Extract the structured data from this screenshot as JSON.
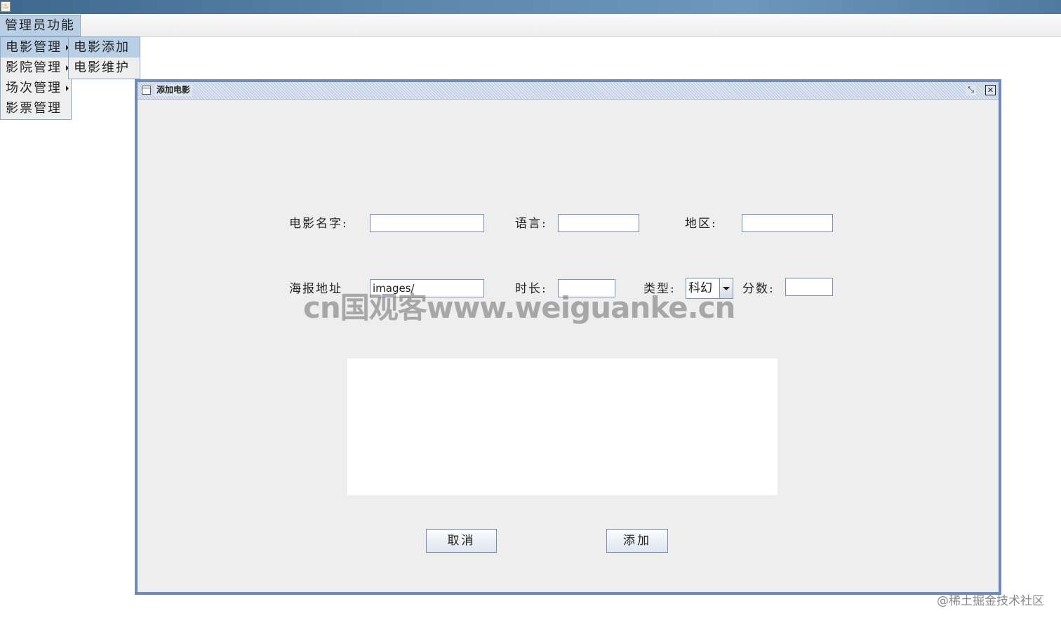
{
  "window": {
    "title_icon": "java-cup-icon"
  },
  "menubar": {
    "top_menu": "管理员功能"
  },
  "admin_menu": {
    "items": [
      {
        "label": "电影管理",
        "has_submenu": true
      },
      {
        "label": "影院管理",
        "has_submenu": true
      },
      {
        "label": "场次管理",
        "has_submenu": true
      },
      {
        "label": "影票管理",
        "has_submenu": false
      }
    ]
  },
  "movie_submenu": {
    "items": [
      {
        "label": "电影添加"
      },
      {
        "label": "电影维护"
      }
    ]
  },
  "dialog": {
    "title": "添加电影",
    "form": {
      "name_label": "电影名字:",
      "name_value": "",
      "language_label": "语言:",
      "language_value": "",
      "region_label": "地区:",
      "region_value": "",
      "poster_label": "海报地址",
      "poster_value": "images/",
      "duration_label": "时长:",
      "duration_value": "",
      "type_label": "类型:",
      "type_selected": "科幻",
      "score_label": "分数:",
      "score_value": ""
    },
    "description_value": "",
    "cancel_label": "取消",
    "add_label": "添加"
  },
  "watermark": "cn国观客www.weiguanke.cn",
  "corner_watermark": "@稀土掘金技术社区",
  "colors": {
    "selection": "#b8cfe5",
    "frame_border": "#7089b7",
    "panel_bg": "#eeeeee"
  }
}
